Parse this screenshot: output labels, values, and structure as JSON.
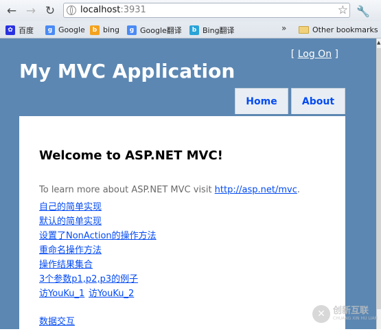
{
  "browser": {
    "url_host": "localhost",
    "url_port": ":3931",
    "icons": {
      "back": "back-arrow-icon",
      "forward": "forward-arrow-icon",
      "reload": "reload-icon",
      "star": "star-icon",
      "wrench": "wrench-icon"
    }
  },
  "bookmarks": {
    "items": [
      {
        "label": "百度",
        "icon": "baidu-paw-icon"
      },
      {
        "label": "Google",
        "icon": "google-icon"
      },
      {
        "label": "bing",
        "icon": "bing-icon"
      },
      {
        "label": "Google翻译",
        "icon": "google-icon"
      },
      {
        "label": "Bing翻译",
        "icon": "bing-translate-icon"
      }
    ],
    "overflow": "»",
    "other": "Other bookmarks"
  },
  "site": {
    "title": "My MVC Application",
    "logon_open": "[ ",
    "logon_link": "Log On",
    "logon_close": " ]",
    "menu": [
      {
        "label": "Home"
      },
      {
        "label": "About"
      }
    ]
  },
  "main": {
    "heading": "Welcome to ASP.NET MVC!",
    "intro_text": "To learn more about ASP.NET MVC visit ",
    "intro_link": "http://asp.net/mvc",
    "intro_end": ".",
    "links": [
      "自己的简单实现",
      "默认的简单实现",
      "设置了NonAction的操作方法",
      "重命名操作方法",
      "操作结果集合",
      "3个参数p1,p2,p3的例子"
    ],
    "youku_links": [
      "访YouKu_1",
      "访YouKu_2"
    ],
    "data_link": "数据交互"
  },
  "watermark": {
    "text": "创新互联",
    "sub": "CHUANG XIN HU LIAN"
  },
  "colors": {
    "page_bg": "#5c87b2",
    "link": "#034af3",
    "tab_bg": "#e8eef4"
  }
}
